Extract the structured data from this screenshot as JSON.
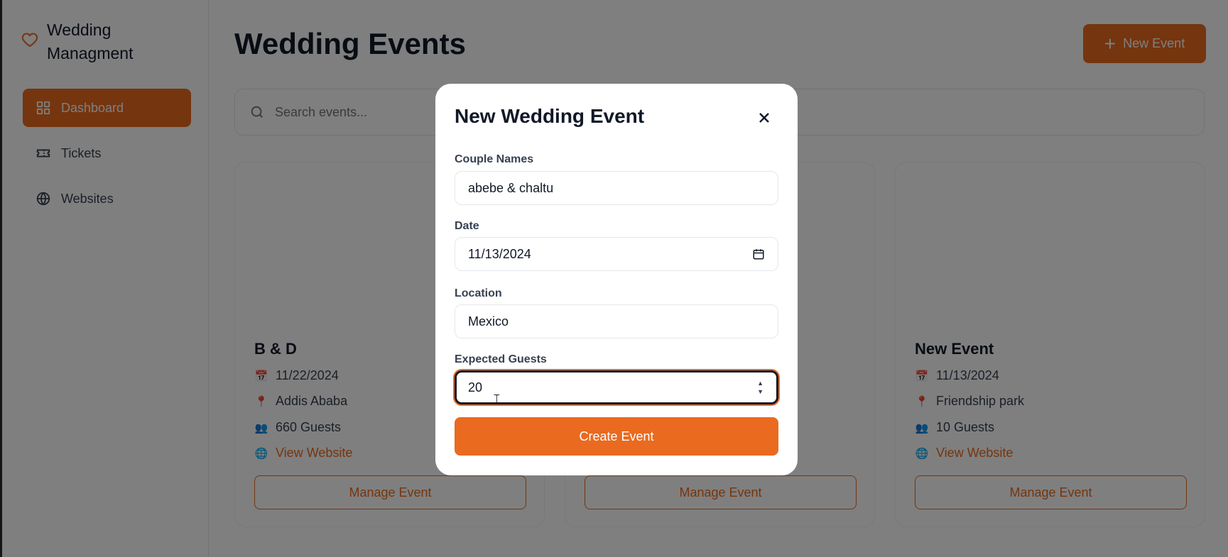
{
  "sidebar": {
    "brand": "Wedding Managment",
    "items": [
      {
        "label": "Dashboard",
        "icon": "dashboard-grid-icon",
        "active": true
      },
      {
        "label": "Tickets",
        "icon": "ticket-icon",
        "active": false
      },
      {
        "label": "Websites",
        "icon": "globe-icon",
        "active": false
      }
    ]
  },
  "header": {
    "title": "Wedding Events",
    "new_event_label": "New Event"
  },
  "search": {
    "placeholder": "Search events..."
  },
  "events": [
    {
      "title": "B & D",
      "date": "11/22/2024",
      "location": "Addis Ababa",
      "guests": "660 Guests",
      "website_label": "View Website",
      "manage_label": "Manage Event"
    },
    {
      "title": "",
      "date": "",
      "location": "",
      "guests": "",
      "website_label": "",
      "manage_label": "Manage Event"
    },
    {
      "title": "New Event",
      "date": "11/13/2024",
      "location": "Friendship park",
      "guests": "10 Guests",
      "website_label": "View Website",
      "manage_label": "Manage Event"
    }
  ],
  "modal": {
    "title": "New Wedding Event",
    "couple_label": "Couple Names",
    "couple_value": "abebe & chaltu",
    "date_label": "Date",
    "date_value": "11/13/2024",
    "location_label": "Location",
    "location_value": "Mexico",
    "guests_label": "Expected Guests",
    "guests_value": "20",
    "submit_label": "Create Event"
  },
  "colors": {
    "accent": "#ea6a1f",
    "overlay": "rgba(0,0,0,0.5)"
  }
}
